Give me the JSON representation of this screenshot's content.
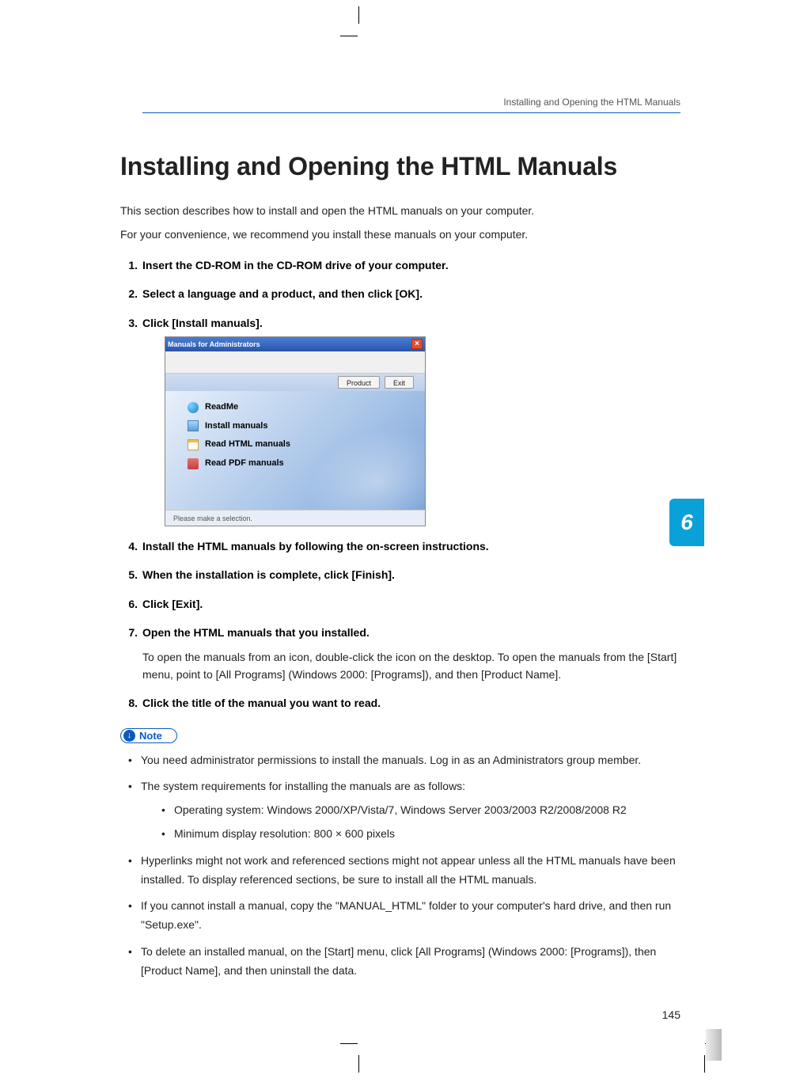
{
  "header": {
    "running": "Installing and Opening the HTML Manuals"
  },
  "title": "Installing and Opening the HTML Manuals",
  "intro1": "This section describes how to install and open the HTML manuals on your computer.",
  "intro2": "For your convenience, we recommend you install these manuals on your computer.",
  "steps": [
    {
      "n": "1.",
      "label": "Insert the CD-ROM in the CD-ROM drive of your computer."
    },
    {
      "n": "2.",
      "label": "Select a language and a product, and then click [OK]."
    },
    {
      "n": "3.",
      "label": "Click [Install manuals]."
    },
    {
      "n": "4.",
      "label": "Install the HTML manuals by following the on-screen instructions."
    },
    {
      "n": "5.",
      "label": "When the installation is complete, click [Finish]."
    },
    {
      "n": "6.",
      "label": "Click [Exit]."
    },
    {
      "n": "7.",
      "label": "Open the HTML manuals that you installed.",
      "desc": "To open the manuals from an icon, double-click the icon on the desktop. To open the manuals from the [Start] menu, point to [All Programs] (Windows 2000: [Programs]), and then [Product Name]."
    },
    {
      "n": "8.",
      "label": "Click the title of the manual you want to read."
    }
  ],
  "screenshot": {
    "title": "Manuals for Administrators",
    "buttons": {
      "product": "Product",
      "exit": "Exit"
    },
    "items": [
      "ReadMe",
      "Install manuals",
      "Read HTML manuals",
      "Read PDF manuals"
    ],
    "status": "Please make a selection."
  },
  "note_label": "Note",
  "notes": {
    "n1": "You need administrator permissions to install the manuals. Log in as an Administrators group member.",
    "n2": "The system requirements for installing the manuals are as follows:",
    "n2a": "Operating system: Windows 2000/XP/Vista/7, Windows Server 2003/2003 R2/2008/2008 R2",
    "n2b": "Minimum display resolution: 800 × 600 pixels",
    "n3": "Hyperlinks might not work and referenced sections might not appear unless all the HTML manuals have been installed. To display referenced sections, be sure to install all the HTML manuals.",
    "n4": "If you cannot install a manual, copy the \"MANUAL_HTML\" folder to your computer's hard drive, and then run \"Setup.exe\".",
    "n5": "To delete an installed manual, on the [Start] menu, click [All Programs] (Windows 2000: [Programs]), then [Product Name], and then uninstall the data."
  },
  "chapter": "6",
  "page_number": "145"
}
